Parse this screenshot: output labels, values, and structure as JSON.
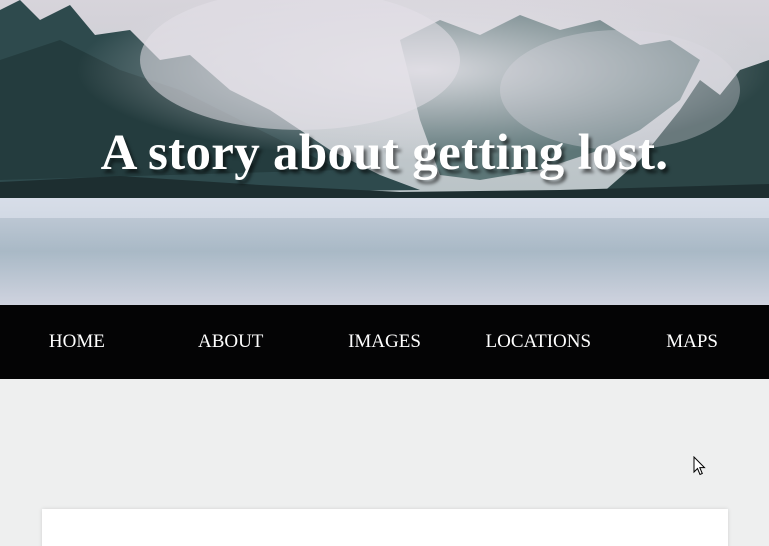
{
  "hero": {
    "title": "A story about getting lost."
  },
  "nav": {
    "items": [
      {
        "label": "HOME"
      },
      {
        "label": "ABOUT"
      },
      {
        "label": "IMAGES"
      },
      {
        "label": "LOCATIONS"
      },
      {
        "label": "MAPS"
      }
    ]
  },
  "colors": {
    "navbar_bg": "#040405",
    "page_bg": "#eeefef",
    "card_bg": "#ffffff",
    "title_text": "#ffffff"
  },
  "icons": {
    "cursor": "mouse-pointer-icon"
  }
}
